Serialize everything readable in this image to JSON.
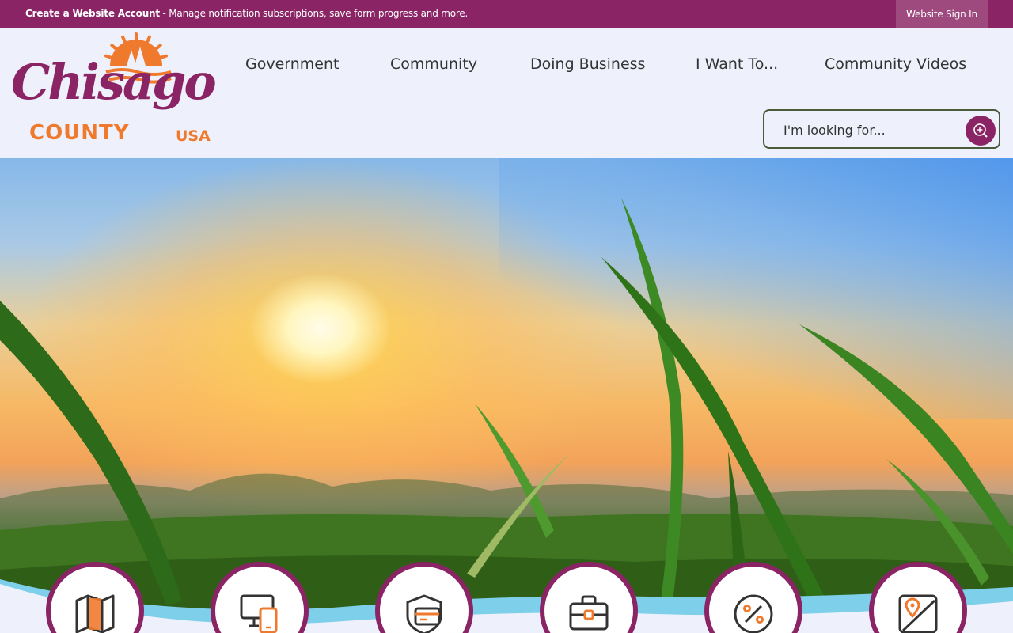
{
  "topbar": {
    "create_account_bold": "Create a Website Account",
    "create_account_rest": " - Manage notification subscriptions, save form progress and more.",
    "sign_in": "Website Sign In"
  },
  "logo": {
    "script": "Chisago",
    "county": "COUNTY",
    "usa": "USA"
  },
  "nav": {
    "items": [
      "Government",
      "Community",
      "Doing Business",
      "I Want To...",
      "Community Videos"
    ]
  },
  "search": {
    "placeholder": "I'm looking for..."
  },
  "quick_links": {
    "icons": [
      "map-icon",
      "devices-icon",
      "payment-card-icon",
      "briefcase-icon",
      "percent-icon",
      "map-pin-icon"
    ]
  },
  "colors": {
    "brand_purple": "#8a2465",
    "brand_orange": "#ef7a2e",
    "header_bg": "#eef1fb",
    "wave_blue": "#7ecfea"
  }
}
